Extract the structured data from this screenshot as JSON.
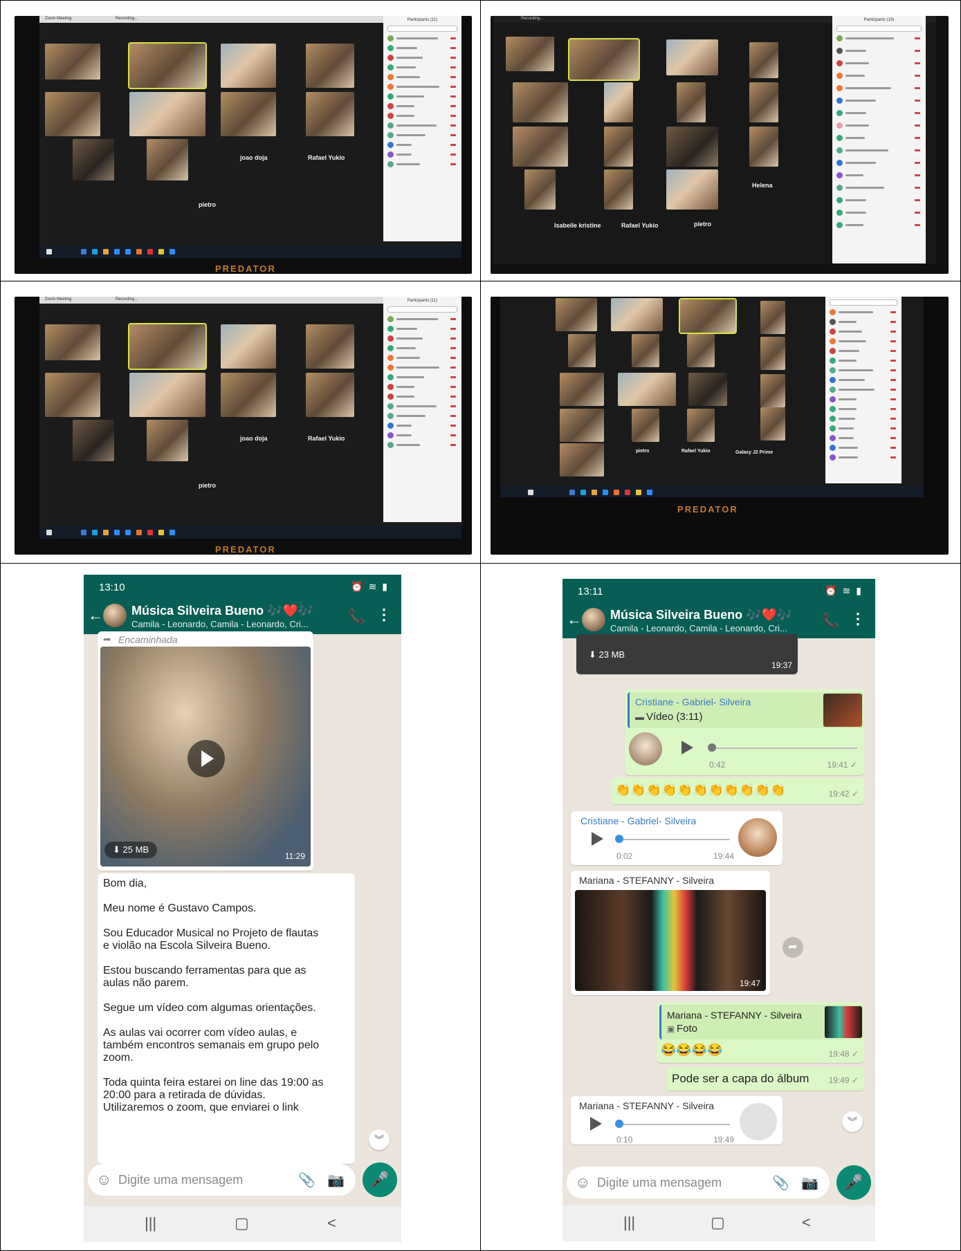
{
  "zoom": {
    "window_title": "Zoom Meeting",
    "recording": "Recording...",
    "participants_header": "Participants (11)",
    "participants_header_b": "Participants (19)",
    "find_placeholder": "Find a participant",
    "brand": "PREDATOR",
    "panel_a": {
      "labels": [
        "joao doja",
        "Rafael Yukio",
        "pietro"
      ]
    },
    "panel_b": {
      "labels": [
        "Helena",
        "Isabelle kristine",
        "Rafael Yukio",
        "pietro"
      ]
    },
    "panel_d": {
      "labels": [
        "pietro",
        "Rafael Yukio",
        "Galaxy J2 Prime"
      ]
    }
  },
  "phone_left": {
    "status_time": "13:10",
    "group_name": "Música Silveira Bueno 🎶❤️🎶",
    "group_members": "Camila - Leonardo, Camila - Leonardo, Cri...",
    "forwarded_label": "Encaminhada",
    "video_size": "25 MB",
    "video_time": "11:29",
    "message": "Bom dia,\n\nMeu nome é Gustavo Campos.\n\nSou Educador Musical no Projeto de flautas\ne violão na Escola  Silveira Bueno.\n\nEstou buscando ferramentas para que as\naulas não parem.\n\nSegue um vídeo com algumas orientações.\n\nAs aulas vai ocorrer  com vídeo aulas, e\ntambém  encontros semanais em grupo pelo\nzoom.\n\nToda quinta feira estarei on line das 19:00 as\n20:00 para a retirada de dúvidas.\nUtilizaremos o zoom, que   enviarei o link",
    "composer_placeholder": "Digite uma mensagem"
  },
  "phone_right": {
    "status_time": "13:11",
    "group_name": "Música Silveira Bueno 🎶❤️🎶",
    "group_members": "Camila - Leonardo, Camila - Leonardo, Cri...",
    "top_video_size": "23 MB",
    "top_video_time": "19:37",
    "quote1_sender": "Cristiane - Gabriel- Silveira",
    "quote1_type": "Vídeo (3:11)",
    "audio1_elapsed": "0:42",
    "audio1_time": "19:41 ✓",
    "clap_emojis": "👏👏👏👏👏👏👏👏👏👏👏",
    "clap_time": "19:42 ✓",
    "audio2_sender": "Cristiane - Gabriel- Silveira",
    "audio2_elapsed": "0:02",
    "audio2_time": "19:44",
    "image_sender": "Mariana - STEFANNY - Silveira",
    "image_time": "19:47",
    "quote2_sender": "Mariana - STEFANNY - Silveira",
    "quote2_type": "Foto",
    "laugh_emojis": "😂😂😂😂",
    "laugh_time": "19:48 ✓",
    "reply_text": "Pode ser a capa do álbum",
    "reply_time": "19:49 ✓",
    "audio3_sender": "Mariana - STEFANNY - Silveira",
    "audio3_elapsed": "0:10",
    "audio3_time": "19:49",
    "composer_placeholder": "Digite uma mensagem"
  },
  "colors": {
    "whatsapp_header": "#075e54",
    "outgoing_bubble": "#dcf8c6",
    "chat_bg": "#ece5dd",
    "mic_button": "#0a8a74"
  }
}
